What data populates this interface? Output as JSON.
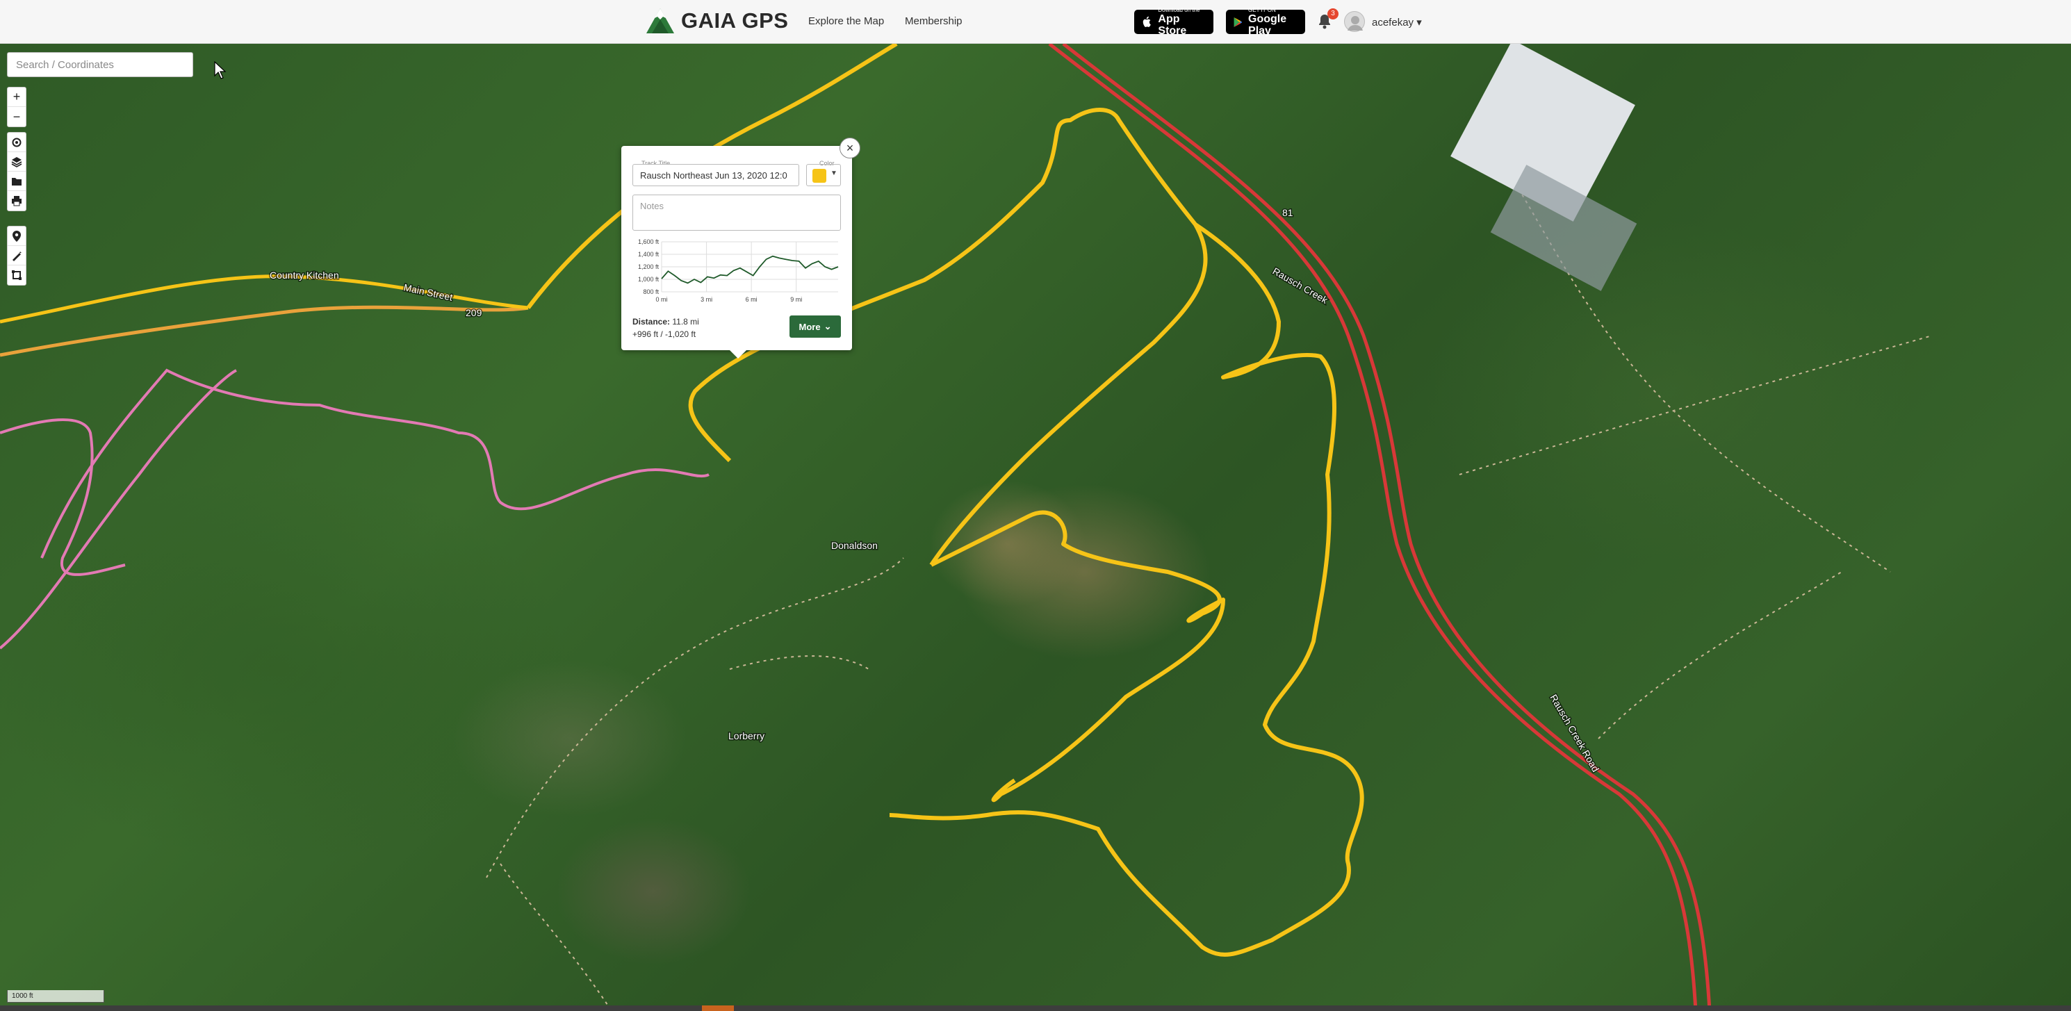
{
  "header": {
    "brand": "GAIA GPS",
    "nav": [
      "Explore the Map",
      "Membership"
    ],
    "app_store": {
      "small": "Download on the",
      "big": "App Store"
    },
    "google_play": {
      "small": "GET IT ON",
      "big": "Google Play"
    },
    "notification_count": "3",
    "username": "acefekay"
  },
  "search": {
    "placeholder": "Search / Coordinates"
  },
  "toolbar": {
    "zoom": [
      {
        "icon": "plus-icon",
        "glyph": "+"
      },
      {
        "icon": "minus-icon",
        "glyph": "−"
      }
    ],
    "group1": [
      {
        "icon": "locate-icon"
      },
      {
        "icon": "layers-icon"
      },
      {
        "icon": "folder-icon"
      },
      {
        "icon": "print-icon"
      }
    ],
    "group2": [
      {
        "icon": "waypoint-icon"
      },
      {
        "icon": "draw-route-icon"
      },
      {
        "icon": "area-icon"
      }
    ]
  },
  "popup": {
    "track_title_label": "Track Title",
    "track_title_value": "Rausch Northeast Jun 13, 2020 12:0",
    "color_label": "Color",
    "track_color": "#f6c417",
    "notes_placeholder": "Notes",
    "elevation": {
      "y_ticks": [
        "1,600 ft",
        "1,400 ft",
        "1,200 ft",
        "1,000 ft",
        "800 ft"
      ],
      "x_ticks": [
        "0 mi",
        "3 mi",
        "6 mi",
        "9 mi"
      ],
      "profile_ft": [
        1010,
        1130,
        1060,
        980,
        940,
        1000,
        950,
        1040,
        1020,
        1070,
        1060,
        1140,
        1180,
        1120,
        1060,
        1200,
        1320,
        1370,
        1340,
        1320,
        1300,
        1290,
        1180,
        1250,
        1290,
        1200,
        1160,
        1200
      ]
    },
    "distance_label": "Distance:",
    "distance_value": "11.8 mi",
    "elevation_gain_loss": "+996 ft / -1,020 ft",
    "more_label": "More"
  },
  "map_labels": {
    "main_street": "Main Street",
    "restaurant": "Country Kitchen",
    "rausch_creek": "Rausch Creek",
    "rausch_creek_road": "Rausch Creek Road",
    "donaldson": "Donaldson",
    "lorberry": "Lorberry",
    "route_209": "209",
    "route_81": "81"
  },
  "scale_label": "1000 ft",
  "colors": {
    "track": "#f6c417",
    "highway": "#d83838",
    "other_track": "#e37ab4",
    "brand_green": "#2b6a3a"
  }
}
